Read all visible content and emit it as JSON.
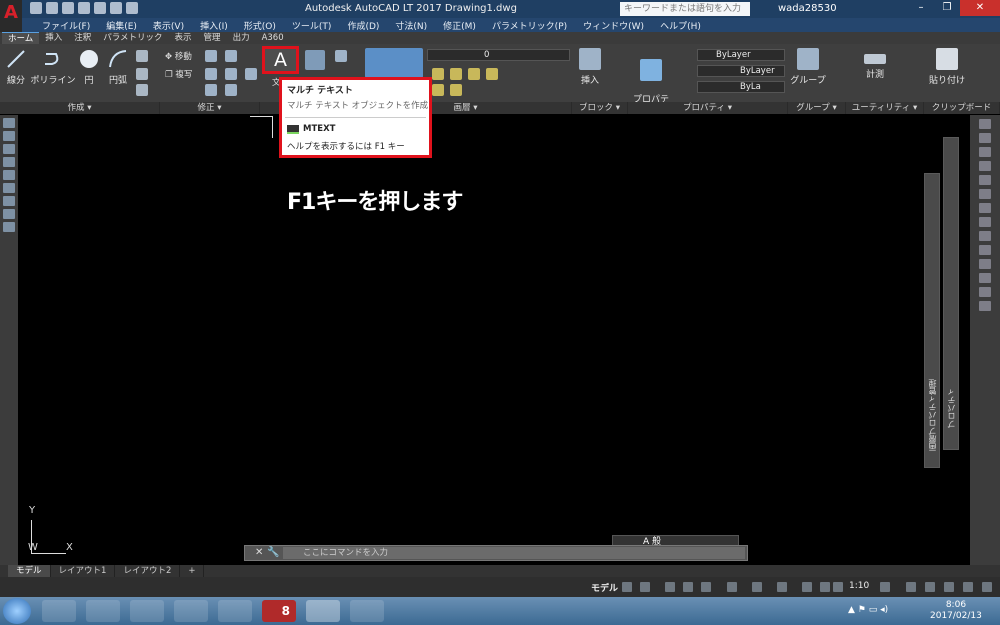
{
  "window": {
    "title": "Autodesk AutoCAD LT 2017    Drawing1.dwg",
    "search_placeholder": "キーワードまたは語句を入力",
    "user": "wada28530",
    "help_label": "?"
  },
  "menu": [
    "ファイル(F)",
    "編集(E)",
    "表示(V)",
    "挿入(I)",
    "形式(O)",
    "ツール(T)",
    "作成(D)",
    "寸法(N)",
    "修正(M)",
    "パラメトリック(P)",
    "ウィンドウ(W)",
    "ヘルプ(H)"
  ],
  "ribbon_tabs": [
    "ホーム",
    "挿入",
    "注釈",
    "パラメトリック",
    "表示",
    "管理",
    "出力",
    "A360"
  ],
  "ribbon": {
    "draw_tools": [
      "線分",
      "ポリライン",
      "円",
      "円弧"
    ],
    "modify_tools": [
      "移動",
      "複写"
    ],
    "text_button_glyph": "A",
    "text_button_label": "文",
    "layer_value": "0",
    "insert_label": "挿入",
    "properties_copy_label": "プロパティ\nコピー",
    "bylayer_1": "ByLayer",
    "bylayer_2": "ByLayer",
    "bylayer_3": "ByLa",
    "group_label": "グループ",
    "measure_label": "計測",
    "paste_label": "貼り付け",
    "panels": [
      "作成 ▾",
      "修正 ▾",
      "画層 ▾",
      "ブロック ▾",
      "プロパティ ▾",
      "グループ ▾",
      "ユーティリティ ▾",
      "クリップボード"
    ]
  },
  "tooltip": {
    "title": "マルチ テキスト",
    "description": "マルチ テキスト オブジェクトを作成",
    "command": "MTEXT",
    "help": "ヘルプを表示するには F1 キー"
  },
  "canvas": {
    "instruction": "F1キーを押します",
    "ucs_y": "Y",
    "ucs_w": "W",
    "ucs_x": "X"
  },
  "palettes": {
    "layer_props_label": "画層プロパティ管理",
    "properties_label": "プロパティ"
  },
  "command_line": {
    "placeholder": "ここにコマンドを入力",
    "annotation_text": "A 般"
  },
  "layout_tabs": [
    "モデル",
    "レイアウト1",
    "レイアウト2",
    "+"
  ],
  "status": {
    "model": "モデル",
    "scale": "1:10"
  },
  "taskbar": {
    "time": "8:06",
    "date": "2017/02/13",
    "pdf_badge": "8"
  }
}
